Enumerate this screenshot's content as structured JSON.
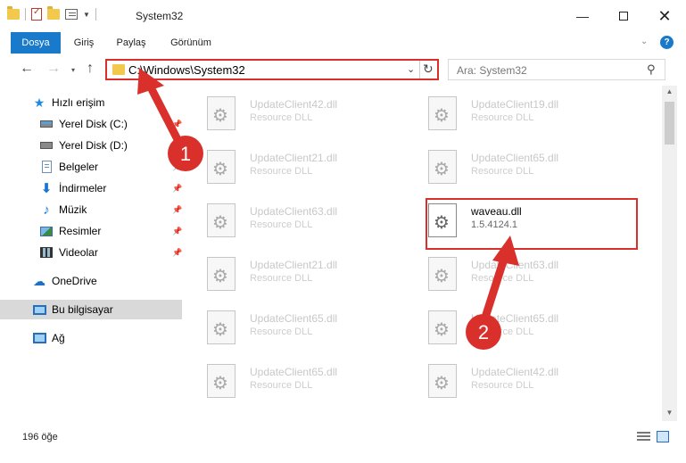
{
  "window": {
    "title": "System32",
    "minimize": "—",
    "close": "✕"
  },
  "ribbon": {
    "tabs": [
      "Dosya",
      "Giriş",
      "Paylaş",
      "Görünüm"
    ],
    "collapse_glyph": "⌄",
    "help_glyph": "?"
  },
  "nav": {
    "back": "←",
    "forward": "→",
    "recent": "▾",
    "up": "↑",
    "address": "C:\\Windows\\System32",
    "address_dropdown": "⌄",
    "refresh": "↻",
    "search_placeholder": "Ara: System32",
    "search_icon": "⚲"
  },
  "sidebar": {
    "items": [
      {
        "label": "Hızlı erişim",
        "icon": "star-icon",
        "pinned": false
      },
      {
        "label": "Yerel Disk (C:)",
        "icon": "drive-c-icon",
        "pinned": true
      },
      {
        "label": "Yerel Disk (D:)",
        "icon": "drive-d-icon",
        "pinned": false
      },
      {
        "label": "Belgeler",
        "icon": "documents-icon",
        "pinned": true
      },
      {
        "label": "İndirmeler",
        "icon": "downloads-icon",
        "pinned": true
      },
      {
        "label": "Müzik",
        "icon": "music-icon",
        "pinned": true
      },
      {
        "label": "Resimler",
        "icon": "pictures-icon",
        "pinned": true
      },
      {
        "label": "Videolar",
        "icon": "videos-icon",
        "pinned": true
      },
      {
        "label": "OneDrive",
        "icon": "onedrive-icon",
        "pinned": false
      },
      {
        "label": "Bu bilgisayar",
        "icon": "this-pc-icon",
        "pinned": false
      },
      {
        "label": "Ağ",
        "icon": "network-icon",
        "pinned": false
      }
    ],
    "pin_glyph": "📌"
  },
  "files": {
    "left_column": [
      {
        "name": "UpdateClient42.dll",
        "desc": "Resource DLL"
      },
      {
        "name": "UpdateClient21.dll",
        "desc": "Resource DLL"
      },
      {
        "name": "UpdateClient63.dll",
        "desc": "Resource DLL"
      },
      {
        "name": "UpdateClient21.dll",
        "desc": "Resource DLL"
      },
      {
        "name": "UpdateClient65.dll",
        "desc": "Resource DLL"
      },
      {
        "name": "UpdateClient65.dll",
        "desc": "Resource DLL"
      }
    ],
    "right_column": [
      {
        "name": "UpdateClient19.dll",
        "desc": "Resource DLL"
      },
      {
        "name": "UpdateClient65.dll",
        "desc": "Resource DLL"
      },
      {
        "name": "waveau.dll",
        "desc": "1.5.4124.1",
        "highlight": true
      },
      {
        "name": "UpdateClient63.dll",
        "desc": "Resource DLL"
      },
      {
        "name": "UpdateClient65.dll",
        "desc": "Resource DLL"
      },
      {
        "name": "UpdateClient42.dll",
        "desc": "Resource DLL"
      }
    ]
  },
  "status": {
    "count": "196 öğe"
  },
  "annotations": {
    "step1": "1",
    "step2": "2",
    "color": "#d9302c"
  }
}
